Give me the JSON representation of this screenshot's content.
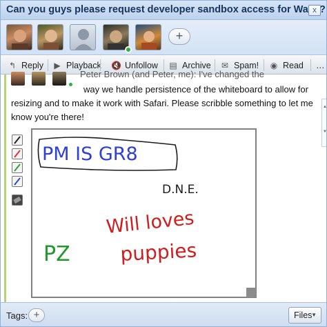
{
  "wave": {
    "title": "Can you guys please request developer sandbox access for Wave?",
    "close_label": "x"
  },
  "participants": {
    "avatars": [
      {
        "name": "participant-1",
        "online": false
      },
      {
        "name": "participant-2",
        "online": false
      },
      {
        "name": "participant-3-placeholder",
        "online": false
      },
      {
        "name": "participant-4",
        "online": true
      },
      {
        "name": "participant-5",
        "online": false
      }
    ],
    "add_label": "+"
  },
  "toolbar": {
    "reply": "Reply",
    "playback": "Playback",
    "unfollow": "Unfollow",
    "archive": "Archive",
    "spam": "Spam!",
    "read": "Read",
    "more": "…"
  },
  "blip": {
    "cut_header": "Peter Brown (and Peter, me): I've changed the",
    "text_line1": "way we handle persistence of the whiteboard to allow for",
    "text_line2": "resizing and to make it work with Safari.  Please scribble something to let me",
    "text_line3": "know you're there!"
  },
  "whiteboard": {
    "tools": [
      "pen-black",
      "pen-red",
      "pen-green",
      "pen-blue",
      "eraser"
    ],
    "scribbles": {
      "boxed": "PM IS GR8",
      "black": "D.N.E.",
      "red_top": "Will loves",
      "red_bottom": "puppies",
      "green": "PZ"
    }
  },
  "footer": {
    "tags_label": "Tags:",
    "add_tag": "+",
    "files_label": "Files"
  },
  "colors": {
    "accent": "#bcd2ee",
    "blip_bar": "#b9d27a",
    "online": "#26b33e"
  }
}
